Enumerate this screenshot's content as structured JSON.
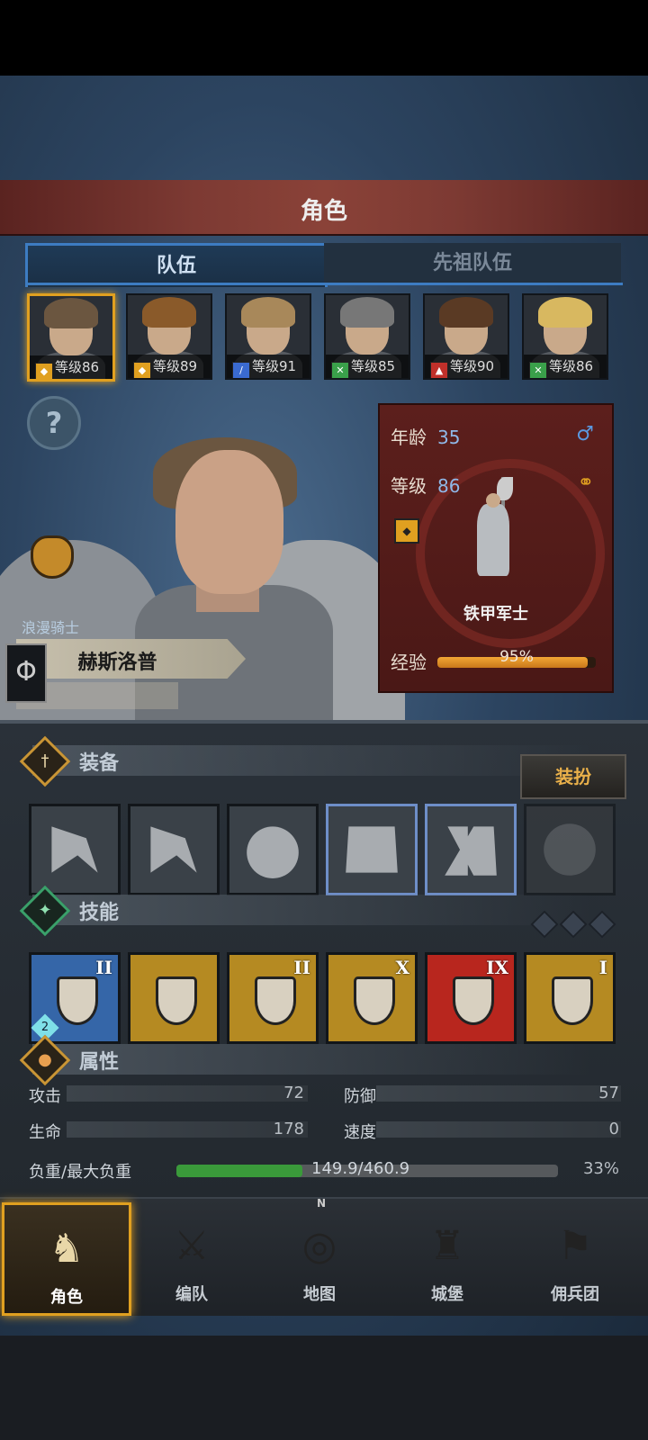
{
  "header": {
    "title": "角色"
  },
  "tabs": [
    {
      "label": "队伍",
      "active": true
    },
    {
      "label": "先祖队伍",
      "active": false
    }
  ],
  "party": [
    {
      "level_label": "等级86",
      "role_icon": "shield-icon",
      "icon_color": "#e0a020",
      "hair": "#6b5640",
      "selected": true
    },
    {
      "level_label": "等级89",
      "role_icon": "shield-icon",
      "icon_color": "#e0a020",
      "hair": "#8a5a2a",
      "selected": false
    },
    {
      "level_label": "等级91",
      "role_icon": "sword-icon",
      "icon_color": "#3a6ad0",
      "hair": "#a8885a",
      "selected": false
    },
    {
      "level_label": "等级85",
      "role_icon": "crossed-swords-icon",
      "icon_color": "#3aa04a",
      "hair": "#777777",
      "selected": false
    },
    {
      "level_label": "等级90",
      "role_icon": "wolf-icon",
      "icon_color": "#c0302a",
      "hair": "#5a3a24",
      "selected": false
    },
    {
      "level_label": "等级86",
      "role_icon": "crossed-swords-icon",
      "icon_color": "#3aa04a",
      "hair": "#d8b860",
      "selected": false
    }
  ],
  "hero": {
    "class_title": "浪漫骑士",
    "name": "赫斯洛普"
  },
  "info": {
    "age_label": "年龄",
    "age": "35",
    "gender_symbol": "♂",
    "level_label": "等级",
    "level": "86",
    "marriage_symbol": "⚭",
    "class_name": "铁甲军士",
    "xp_label": "经验",
    "xp_percent_label": "95%",
    "xp_fraction": 0.95
  },
  "equipment": {
    "title": "装备",
    "dress_button": "装扮",
    "slots": [
      {
        "item": "axe",
        "highlight": false,
        "empty": false
      },
      {
        "item": "axe",
        "highlight": false,
        "empty": false
      },
      {
        "item": "helmet",
        "highlight": false,
        "empty": false
      },
      {
        "item": "plate-armor",
        "highlight": true,
        "empty": false
      },
      {
        "item": "plate-boots",
        "highlight": true,
        "empty": false
      },
      {
        "item": "ring",
        "highlight": false,
        "empty": true
      }
    ]
  },
  "skills": {
    "title": "技能",
    "items": [
      {
        "rank": "II",
        "bg": "#3566a8",
        "badge": "2"
      },
      {
        "rank": "",
        "bg": "#b58a22",
        "badge": ""
      },
      {
        "rank": "II",
        "bg": "#b58a22",
        "badge": ""
      },
      {
        "rank": "X",
        "bg": "#b58a22",
        "badge": ""
      },
      {
        "rank": "IX",
        "bg": "#b8261e",
        "badge": ""
      },
      {
        "rank": "I",
        "bg": "#b58a22",
        "badge": ""
      }
    ]
  },
  "attributes": {
    "title": "属性",
    "attack_label": "攻击",
    "attack": "72",
    "defense_label": "防御",
    "defense": "57",
    "hp_label": "生命",
    "hp": "178",
    "speed_label": "速度",
    "speed": "0",
    "load_label": "负重/最大负重",
    "load_value": "149.9/460.9",
    "load_percent": "33%",
    "load_fraction": 0.33
  },
  "nav": [
    {
      "label": "角色",
      "active": true,
      "icon": "knight-icon"
    },
    {
      "label": "编队",
      "active": false,
      "icon": "formation-icon"
    },
    {
      "label": "地图",
      "active": false,
      "icon": "compass-map-icon"
    },
    {
      "label": "城堡",
      "active": false,
      "icon": "castle-icon"
    },
    {
      "label": "佣兵团",
      "active": false,
      "icon": "mercenary-icon"
    }
  ],
  "compass_n": "N"
}
